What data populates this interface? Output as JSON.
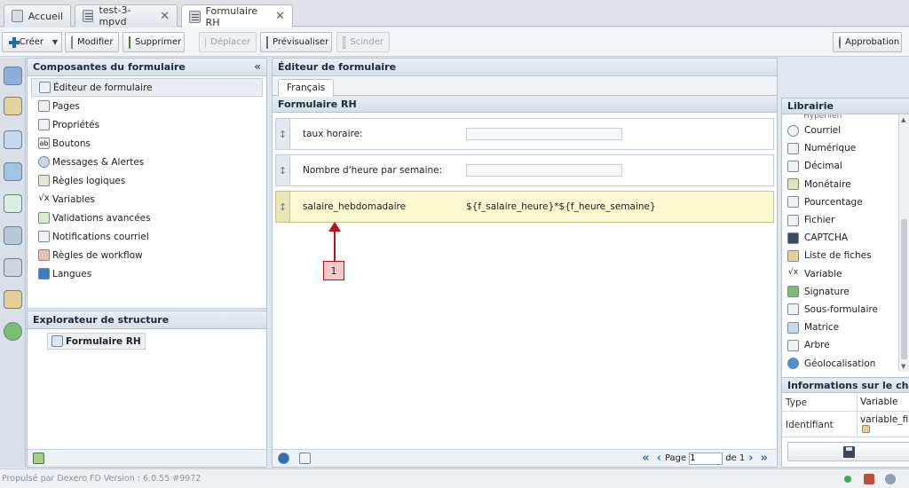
{
  "tabs": [
    {
      "label": "Accueil",
      "icon": "home-icon",
      "closable": false
    },
    {
      "label": "test-3-mpvd",
      "icon": "form-icon",
      "closable": true
    },
    {
      "label": "Formulaire RH",
      "icon": "form-icon",
      "closable": true,
      "active": true
    }
  ],
  "toolbar": {
    "create": "Créer",
    "modify": "Modifier",
    "delete": "Supprimer",
    "move": "Déplacer",
    "preview": "Prévisualiser",
    "split": "Scinder",
    "approval": "Approbation"
  },
  "left_panel": {
    "title": "Composantes du formulaire",
    "items": [
      {
        "label": "Éditeur de formulaire",
        "selected": true
      },
      {
        "label": "Pages"
      },
      {
        "label": "Propriétés"
      },
      {
        "label": "Boutons"
      },
      {
        "label": "Messages & Alertes"
      },
      {
        "label": "Règles logiques"
      },
      {
        "label": "Variables"
      },
      {
        "label": "Validations avancées"
      },
      {
        "label": "Notifications courriel"
      },
      {
        "label": "Règles de workflow"
      },
      {
        "label": "Langues"
      }
    ],
    "explorer_title": "Explorateur de structure",
    "tree_root": "Formulaire RH"
  },
  "editor": {
    "title": "Éditeur de formulaire",
    "language_tab": "Français",
    "form_title": "Formulaire RH",
    "fields": [
      {
        "label": "taux horaire:",
        "value": ""
      },
      {
        "label": "Nombre d'heure par semaine:",
        "value": ""
      },
      {
        "label": "salaire_hebdomadaire",
        "formula": "${f_salaire_heure}*${f_heure_semaine}"
      }
    ],
    "annotation": "1",
    "pager": {
      "page_label": "Page",
      "page_value": "1",
      "of_label": "de 1"
    }
  },
  "library": {
    "title": "Librairie",
    "cut_item": "Hyperlien",
    "items": [
      "Courriel",
      "Numérique",
      "Décimal",
      "Monétaire",
      "Pourcentage",
      "Fichier",
      "CAPTCHA",
      "Liste de fiches",
      "Variable",
      "Signature",
      "Sous-formulaire",
      "Matrice",
      "Arbre",
      "Géolocalisation"
    ]
  },
  "info": {
    "title": "Informations sur le champ",
    "rows": [
      {
        "key": "Type",
        "value": "Variable"
      },
      {
        "key": "Identifiant",
        "value": "variable_fie"
      }
    ]
  },
  "status": {
    "powered_by": "Propulsé par Dexero FD Version : 6.0.55 #9972"
  },
  "colors": {
    "accent": "#2d6db6",
    "highlight": "#fbf9cf",
    "annotation": "#b3141d"
  }
}
